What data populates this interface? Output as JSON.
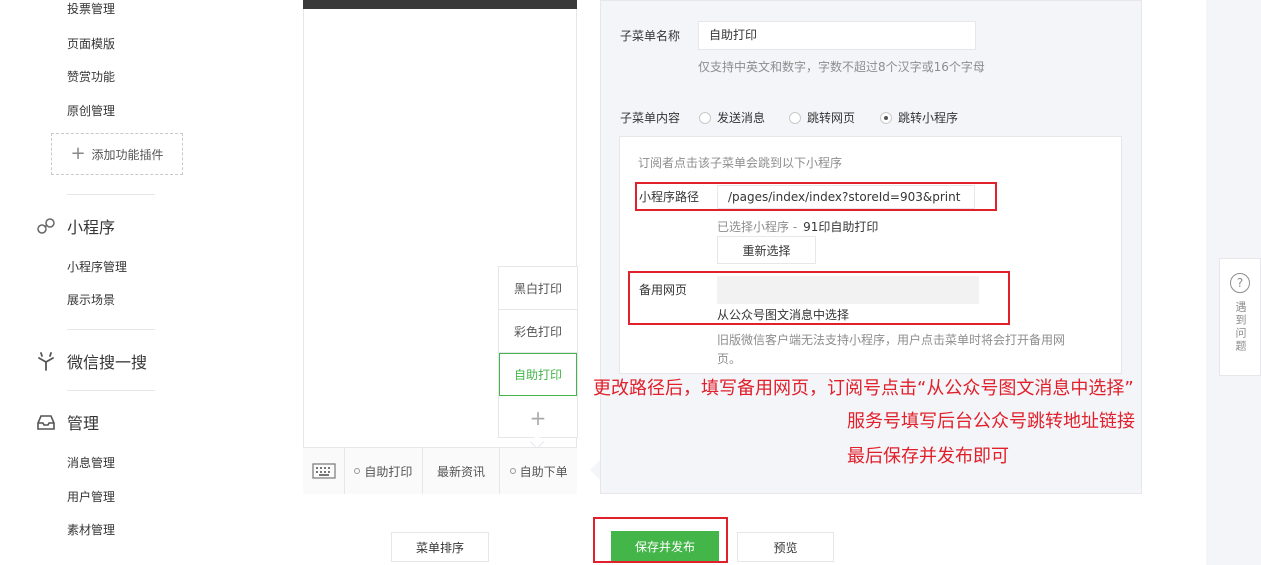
{
  "sidebar": {
    "top_items": [
      "投票管理",
      "页面模版",
      "赞赏功能",
      "原创管理"
    ],
    "add_plugin_label": "添加功能插件",
    "sections": [
      {
        "title": "小程序",
        "icon": "link-icon",
        "items": [
          "小程序管理",
          "展示场景"
        ]
      },
      {
        "title": "微信搜一搜",
        "icon": "sparkle-icon",
        "items": []
      },
      {
        "title": "管理",
        "icon": "inbox-icon",
        "items": [
          "消息管理",
          "用户管理",
          "素材管理"
        ]
      }
    ]
  },
  "phone": {
    "submenu": [
      "黑白打印",
      "彩色打印",
      "自助打印"
    ],
    "submenu_active_index": 2,
    "menu_bar": [
      "自助打印",
      "最新资讯",
      "自助下单"
    ]
  },
  "panel": {
    "name_label": "子菜单名称",
    "name_value": "自助打印",
    "name_hint": "仅支持中英文和数字，字数不超过8个汉字或16个字母",
    "content_label": "子菜单内容",
    "radio_options": [
      "发送消息",
      "跳转网页",
      "跳转小程序"
    ],
    "radio_selected_index": 2,
    "box_intro": "订阅者点击该子菜单会跳到以下小程序",
    "path_label": "小程序路径",
    "path_value": "/pages/index/index?storeId=903&print",
    "selected_prefix": "已选择小程序 -",
    "selected_name": "91印自助打印",
    "reselect_label": "重新选择",
    "backup_label": "备用网页",
    "backup_link": "从公众号图文消息中选择",
    "backup_hint_1": "旧版微信客户端无法支持小程序，用户点击菜单时将会打开备用网",
    "backup_hint_2": "页。"
  },
  "annotations": {
    "line1": "更改路径后，填写备用网页，订阅号点击“从公众号图文消息中选择”",
    "line2": "服务号填写后台公众号跳转地址链接",
    "line3": "最后保存并发布即可"
  },
  "buttons": {
    "sort": "菜单排序",
    "save": "保存并发布",
    "preview": "预览"
  },
  "feedback": {
    "icon_text": "?",
    "label": "遇到问题"
  },
  "colors": {
    "accent_green": "#44b549",
    "annotation_red": "#e0202a"
  }
}
